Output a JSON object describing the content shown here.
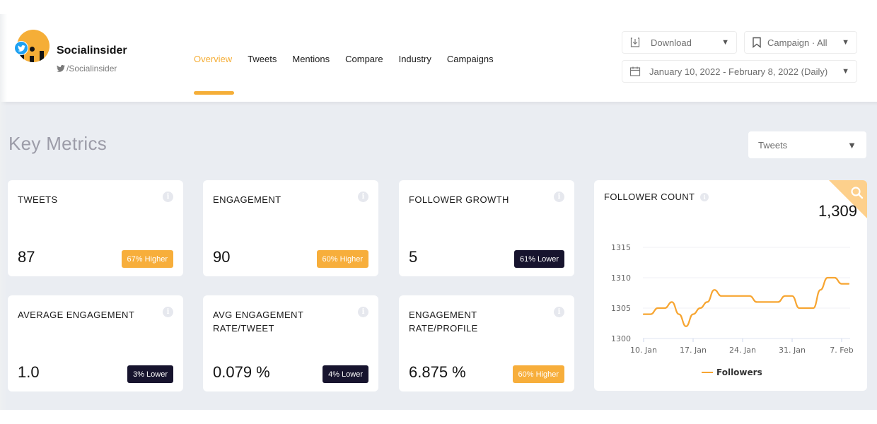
{
  "brand": {
    "name": "Socialinsider",
    "handle": "/Socialinsider",
    "accent_color": "#f5ae37"
  },
  "nav": {
    "items": [
      {
        "label": "Overview",
        "active": true
      },
      {
        "label": "Tweets",
        "active": false
      },
      {
        "label": "Mentions",
        "active": false
      },
      {
        "label": "Compare",
        "active": false
      },
      {
        "label": "Industry",
        "active": false
      },
      {
        "label": "Campaigns",
        "active": false
      }
    ]
  },
  "controls": {
    "download_label": "Download",
    "campaign_label": "Campaign · All",
    "date_range": "January 10, 2022 - February 8, 2022 (Daily)"
  },
  "section": {
    "title": "Key Metrics",
    "metric_select": "Tweets"
  },
  "cards": [
    {
      "label": "TWEETS",
      "value": "87",
      "badge": "67% Higher",
      "trend": "higher"
    },
    {
      "label": "ENGAGEMENT",
      "value": "90",
      "badge": "60% Higher",
      "trend": "higher"
    },
    {
      "label": "FOLLOWER GROWTH",
      "value": "5",
      "badge": "61% Lower",
      "trend": "lower"
    },
    {
      "label": "AVERAGE ENGAGEMENT",
      "value": "1.0",
      "badge": "3% Lower",
      "trend": "lower"
    },
    {
      "label": "AVG ENGAGEMENT RATE/TWEET",
      "value": "0.079 %",
      "badge": "4% Lower",
      "trend": "lower"
    },
    {
      "label": "ENGAGEMENT RATE/PROFILE",
      "value": "6.875 %",
      "badge": "60% Higher",
      "trend": "higher"
    }
  ],
  "follower_card": {
    "label": "FOLLOWER COUNT",
    "value": "1,309"
  },
  "chart_data": {
    "type": "line",
    "title": "FOLLOWER COUNT",
    "x": [
      "Jan 10",
      "Jan 11",
      "Jan 12",
      "Jan 13",
      "Jan 14",
      "Jan 15",
      "Jan 16",
      "Jan 17",
      "Jan 18",
      "Jan 19",
      "Jan 20",
      "Jan 21",
      "Jan 22",
      "Jan 23",
      "Jan 24",
      "Jan 25",
      "Jan 26",
      "Jan 27",
      "Jan 28",
      "Jan 29",
      "Jan 30",
      "Jan 31",
      "Feb 1",
      "Feb 2",
      "Feb 3",
      "Feb 4",
      "Feb 5",
      "Feb 6",
      "Feb 7",
      "Feb 8"
    ],
    "series": [
      {
        "name": "Followers",
        "color": "#f7a531",
        "values": [
          1304,
          1304,
          1305,
          1305,
          1306,
          1304,
          1302,
          1304,
          1305,
          1306,
          1308,
          1307,
          1307,
          1307,
          1307,
          1307,
          1306,
          1306,
          1306,
          1306,
          1307,
          1307,
          1305,
          1305,
          1305,
          1308,
          1310,
          1310,
          1309,
          1309
        ]
      }
    ],
    "xticks": [
      {
        "label": "10. Jan",
        "index": 0
      },
      {
        "label": "17. Jan",
        "index": 7
      },
      {
        "label": "24. Jan",
        "index": 14
      },
      {
        "label": "31. Jan",
        "index": 21
      },
      {
        "label": "7. Feb",
        "index": 28
      }
    ],
    "yticks": [
      1300,
      1305,
      1310,
      1315
    ],
    "ylim": [
      1300,
      1315
    ],
    "grid": true,
    "legend": "bottom-center",
    "xlabel": "",
    "ylabel": ""
  }
}
